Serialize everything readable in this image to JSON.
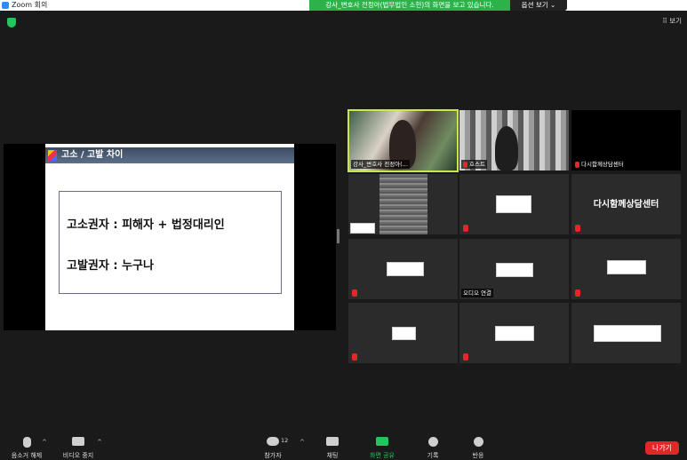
{
  "window": {
    "title": "Zoom 회의"
  },
  "banner": {
    "sharing_text": "강사_변호사 전정아(법무법인 소헌)의 화면을 보고 있습니다.",
    "view_options": "옵션 보기 ⌄"
  },
  "view_button": "⠿ 보기",
  "slide": {
    "title": "고소 / 고발 차이",
    "line1": "고소권자 : 피해자 + 법정대리인",
    "line2": "고발권자 : 누구나"
  },
  "participants": [
    {
      "name": "강사_변호사 전정아(..."
    },
    {
      "name": "호스트"
    },
    {
      "name": "다시함께상담센터"
    },
    {
      "name": ""
    },
    {
      "name": ""
    },
    {
      "name": "다시함께상담센터",
      "big": true
    },
    {
      "name": ""
    },
    {
      "name": "오디오 연결"
    },
    {
      "name": ""
    },
    {
      "name": ""
    },
    {
      "name": ""
    },
    {
      "name": ""
    }
  ],
  "toolbar": {
    "mute": "음소거 해제",
    "video": "비디오 중지",
    "participants": "참가자",
    "participants_count": "12",
    "chat": "채팅",
    "share": "화면 공유",
    "record": "기록",
    "reactions": "반응",
    "leave": "나가기"
  },
  "colors": {
    "share_green": "#2bb34a",
    "leave_red": "#e02828",
    "active_speaker": "#c9e94a"
  }
}
